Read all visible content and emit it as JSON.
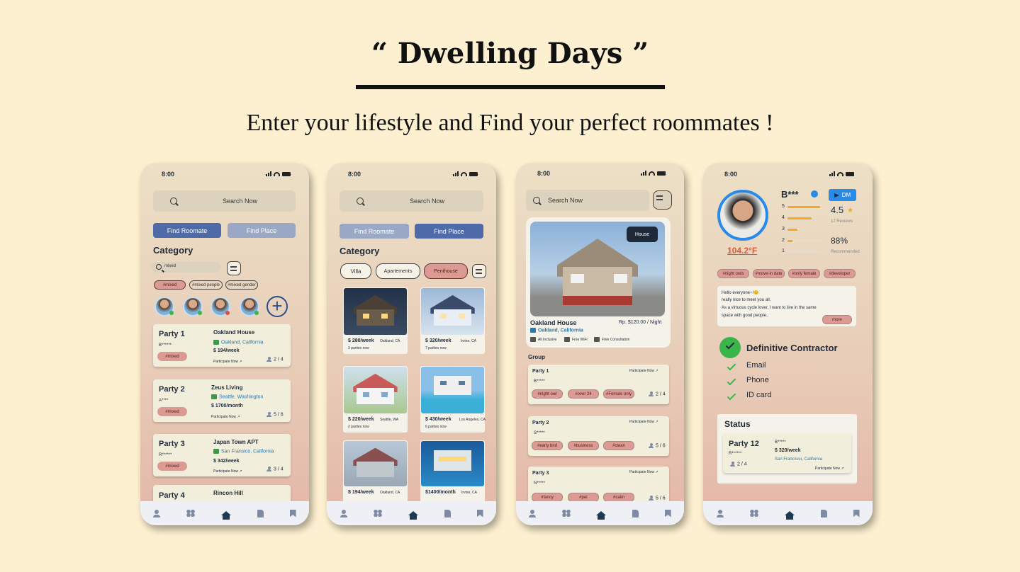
{
  "hero": {
    "title": "“ Dwelling Days ”",
    "subtitle": "Enter your lifestyle and Find your perfect roommates !"
  },
  "status_time": "8:00",
  "search_label": "Search Now",
  "screen1": {
    "btn_roommate": "Find Roomate",
    "btn_place": "Find Place",
    "category": "Category",
    "filter_value": "mixed",
    "tags": [
      "#mixed",
      "#mixed people",
      "#mixed gender"
    ],
    "parties": [
      {
        "name": "Party 1",
        "user": "B******",
        "tag": "#mixed",
        "place": "Oakland House",
        "loc": "Oakland, California",
        "price": "$ 194/week",
        "participate": "Participate Now  ↗",
        "count": "2 / 4"
      },
      {
        "name": "Party 2",
        "user": "A****",
        "tag": "#mixed",
        "place": "Zeus Living",
        "loc": "Seattle, Washington",
        "price": "$ 1700/month",
        "participate": "Participate Now  ↗",
        "count": "5 / 6"
      },
      {
        "name": "Party 3",
        "user": "R******",
        "tag": "#mixed",
        "place": "Japan Town APT",
        "loc": "San Fransico, California",
        "price": "$ 342/week",
        "participate": "Participate Now  ↗",
        "count": "3 / 4"
      },
      {
        "name": "Party 4",
        "place": "Rincon Hill"
      }
    ]
  },
  "screen2": {
    "btn_roommate": "Find Roomate",
    "btn_place": "Find Place",
    "category": "Category",
    "chips": [
      "Villa",
      "Apartements",
      "Penthouse"
    ],
    "listings": [
      {
        "price": "$ 280/week",
        "loc": "Oakland, CA",
        "people": "3 parties now"
      },
      {
        "price": "$ 320/week",
        "loc": "Irvine, CA",
        "people": "7 parties now"
      },
      {
        "price": "$ 220/week",
        "loc": "Seattle, WA",
        "people": "2 parties now"
      },
      {
        "price": "$ 430/week",
        "loc": "Los Angeles, CA",
        "people": "6 parties now"
      },
      {
        "price": "$ 194/week",
        "loc": "Oakland, CA"
      },
      {
        "price": "$1400/month",
        "loc": "Irvine, CA"
      }
    ]
  },
  "screen3": {
    "badge": "House",
    "name": "Oakland House",
    "loc": "Oakland, California",
    "price": "Rp. $120.00 / Night",
    "amenities": [
      "All Inclusive",
      "Free WiFi",
      "Free Consultation"
    ],
    "group": "Group",
    "parties": [
      {
        "name": "Party 1",
        "user": "B*****",
        "participate": "Participate Now  ↗",
        "tags": [
          "#night owl",
          "#over 24",
          "#Female only"
        ],
        "count": "2 / 4"
      },
      {
        "name": "Party 2",
        "user": "S*****",
        "participate": "Participate Now  ↗",
        "tags": [
          "#early bird",
          "#business",
          "#clean"
        ],
        "count": "5 / 6"
      },
      {
        "name": "Party 3",
        "user": "N*****",
        "participate": "Participate Now  ↗",
        "tags": [
          "#fancy",
          "#pet",
          "#calm"
        ],
        "count": "5 / 6"
      }
    ]
  },
  "screen4": {
    "username": "B***",
    "dm": "DM",
    "temp": "104.2°F",
    "rating": "4.5",
    "reviews": "12 Reviews",
    "recommend_pct": "88%",
    "recommend_label": "Recommended",
    "rating_rows": [
      {
        "star": "5",
        "fill": 0.95
      },
      {
        "star": "4",
        "fill": 0.7
      },
      {
        "star": "3",
        "fill": 0.3
      },
      {
        "star": "2",
        "fill": 0.15
      },
      {
        "star": "1",
        "fill": 0.0
      }
    ],
    "tags": [
      "#night owls",
      "#move-in date",
      "#only female",
      "#developer"
    ],
    "bio": [
      "Hello everyone~!😊",
      "really nice to meet you all.",
      "As a virtuous cycle lover, I want to live in the same",
      "space with good people.."
    ],
    "more": "more",
    "contractor": "Definitive Contractor",
    "verified": [
      "Email",
      "Phone",
      "ID card"
    ],
    "status_title": "Status",
    "status_party": {
      "name": "Party 12",
      "user": "R******",
      "uid": "B*****",
      "price": "$ 320/week",
      "loc": "San Francisco, California",
      "count": "2 / 4",
      "participate": "Participate Now  ↗"
    }
  },
  "colors": {
    "accent": "#4e6aa8",
    "tag_pink": "#dd9a93",
    "bg": "#fdf0d0",
    "temp_red": "#e05a3a"
  }
}
